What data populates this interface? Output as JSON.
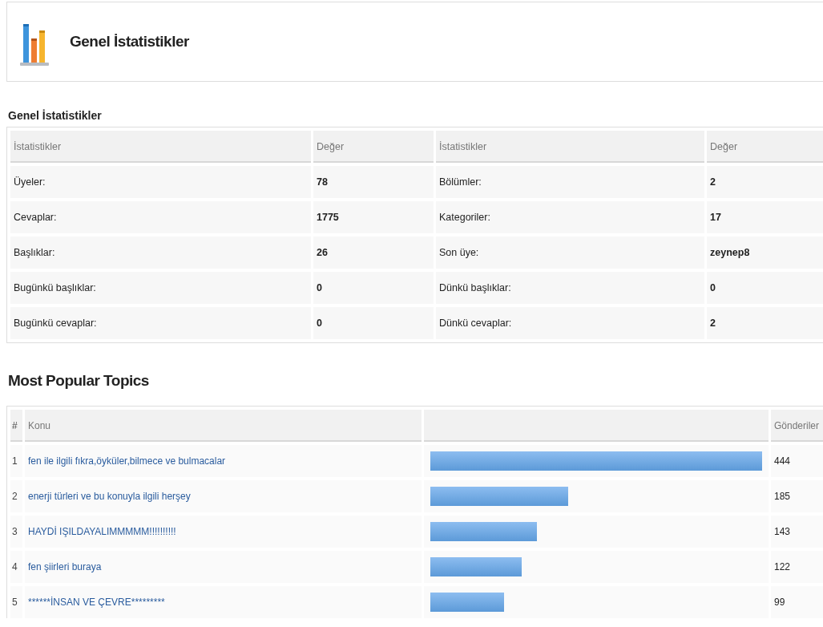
{
  "header": {
    "title": "Genel İstatistikler"
  },
  "stats": {
    "title": "Genel İstatistikler",
    "columns": [
      "İstatistikler",
      "Değer",
      "İstatistikler",
      "Değer"
    ],
    "rows": [
      {
        "label_1": "Üyeler:",
        "value_1": "78",
        "label_2": "Bölümler:",
        "value_2": "2"
      },
      {
        "label_1": "Cevaplar:",
        "value_1": "1775",
        "label_2": "Kategoriler:",
        "value_2": "17"
      },
      {
        "label_1": "Başlıklar:",
        "value_1": "26",
        "label_2": "Son üye:",
        "value_2": "zeynep8"
      },
      {
        "label_1": "Bugünkü başlıklar:",
        "value_1": "0",
        "label_2": "Dünkü başlıklar:",
        "value_2": "0"
      },
      {
        "label_1": "Bugünkü cevaplar:",
        "value_1": "0",
        "label_2": "Dünkü cevaplar:",
        "value_2": "2"
      }
    ]
  },
  "popular": {
    "title": "Most Popular Topics",
    "columns": [
      "#",
      "Konu",
      "Gönderiler"
    ],
    "rows": [
      {
        "rank": "1",
        "topic": "fen ile ilgili fıkra,öyküler,bilmece ve bulmacalar",
        "posts": "444"
      },
      {
        "rank": "2",
        "topic": "enerji türleri ve bu konuyla ilgili herşey",
        "posts": "185"
      },
      {
        "rank": "3",
        "topic": "HAYDİ IŞILDAYALIMMMMM!!!!!!!!!!",
        "posts": "143"
      },
      {
        "rank": "4",
        "topic": "fen şiirleri buraya",
        "posts": "122"
      },
      {
        "rank": "5",
        "topic": "******İNSAN VE ÇEVRE*********",
        "posts": "99"
      }
    ]
  }
}
